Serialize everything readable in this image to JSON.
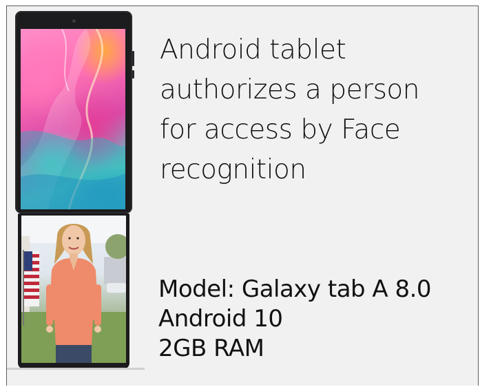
{
  "slide": {
    "title_lines": [
      "Android tablet",
      "authorizes a person",
      "for access by Face",
      "recognition"
    ],
    "specs": [
      "Model: Galaxy tab A 8.0",
      "Android 10",
      "2GB RAM"
    ]
  },
  "images": {
    "top_tablet": "tablet-wallpaper-image",
    "bottom_tablet": "person-face-camera-image"
  },
  "colors": {
    "background": "#f1f1f1",
    "text": "#111111",
    "device_body": "#1c1c1e"
  }
}
